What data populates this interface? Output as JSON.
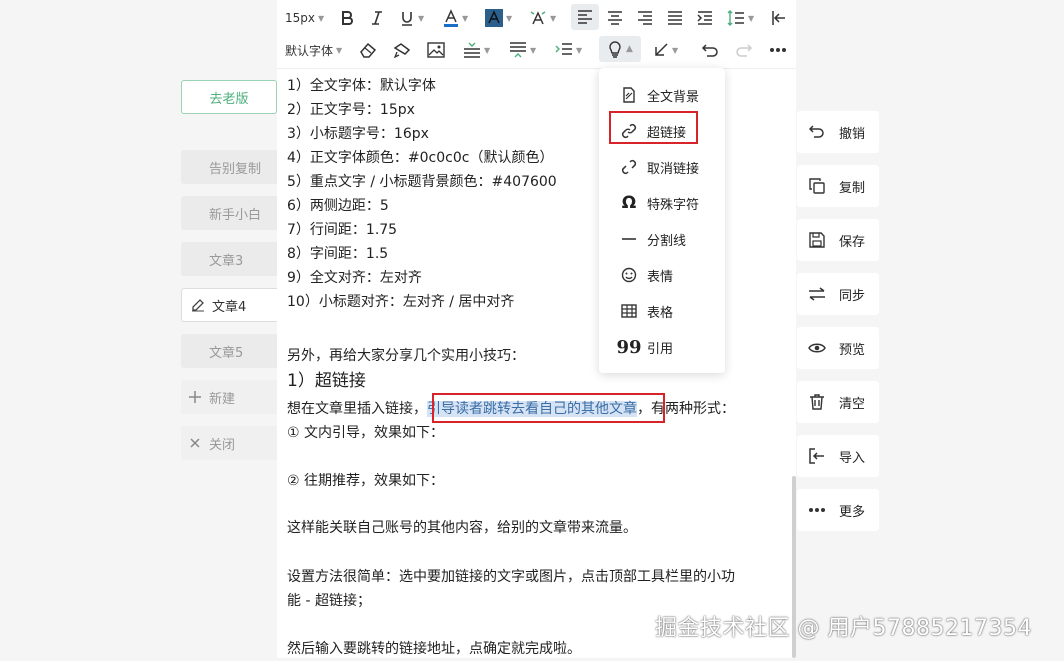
{
  "sidebar": {
    "old_version": "去老版",
    "items": [
      {
        "label": "告别复制"
      },
      {
        "label": "新手小白"
      },
      {
        "label": "文章3"
      },
      {
        "label": "文章4"
      },
      {
        "label": "文章5"
      },
      {
        "label": "新建"
      },
      {
        "label": "关闭"
      }
    ]
  },
  "toolbar": {
    "font_size": "15px",
    "font_family": "默认字体"
  },
  "content": {
    "lines": [
      "1）全文字体：默认字体",
      "2）正文字号：15px",
      "3）小标题字号：16px",
      "4）正文字体颜色：#0c0c0c（默认颜色）",
      "5）重点文字 / 小标题背景颜色：#407600",
      "6）两侧边距：5",
      "7）行间距：1.75",
      "8）字间距：1.5",
      "9）全文对齐：左对齐",
      "10）小标题对齐：左对齐 / 居中对齐"
    ],
    "share_intro": "另外，再给大家分享几个实用小技巧：",
    "heading": "1）超链接",
    "para_prefix": "想在文章里插入链接，",
    "para_link": "引导读者跳转去看自己的其他文章",
    "para_suffix": "，有两种形式：",
    "form1": "① 文内引导，效果如下：",
    "form2": "② 往期推荐，效果如下：",
    "benefit": "这样能关联自己账号的其他内容，给别的文章带来流量。",
    "method_1": "设置方法很简单：选中要加链接的文字或图片，点击顶部工具栏里的小功",
    "method_2": "能 - 超链接；",
    "final": "然后输入要跳转的链接地址，点确定就完成啦。"
  },
  "insert_menu": {
    "items": [
      {
        "label": "全文背景",
        "icon": "background-icon"
      },
      {
        "label": "超链接",
        "icon": "link-icon"
      },
      {
        "label": "取消链接",
        "icon": "unlink-icon"
      },
      {
        "label": "特殊字符",
        "icon": "omega-icon"
      },
      {
        "label": "分割线",
        "icon": "divider-icon"
      },
      {
        "label": "表情",
        "icon": "emoji-icon"
      },
      {
        "label": "表格",
        "icon": "table-icon"
      },
      {
        "label": "引用",
        "icon": "quote-icon"
      }
    ]
  },
  "right_panel": {
    "items": [
      {
        "label": "撤销",
        "icon": "undo-icon"
      },
      {
        "label": "复制",
        "icon": "copy-icon"
      },
      {
        "label": "保存",
        "icon": "save-icon"
      },
      {
        "label": "同步",
        "icon": "sync-icon"
      },
      {
        "label": "预览",
        "icon": "eye-icon"
      },
      {
        "label": "清空",
        "icon": "trash-icon"
      },
      {
        "label": "导入",
        "icon": "import-icon"
      },
      {
        "label": "更多",
        "icon": "more-icon"
      }
    ]
  },
  "watermark": "掘金技术社区 @ 用户57885217354",
  "colors": {
    "accent_green": "#4caf7d",
    "highlight_red": "#d8232a",
    "link_blue": "#3a6ea5",
    "link_bg": "#d6e3f5"
  }
}
